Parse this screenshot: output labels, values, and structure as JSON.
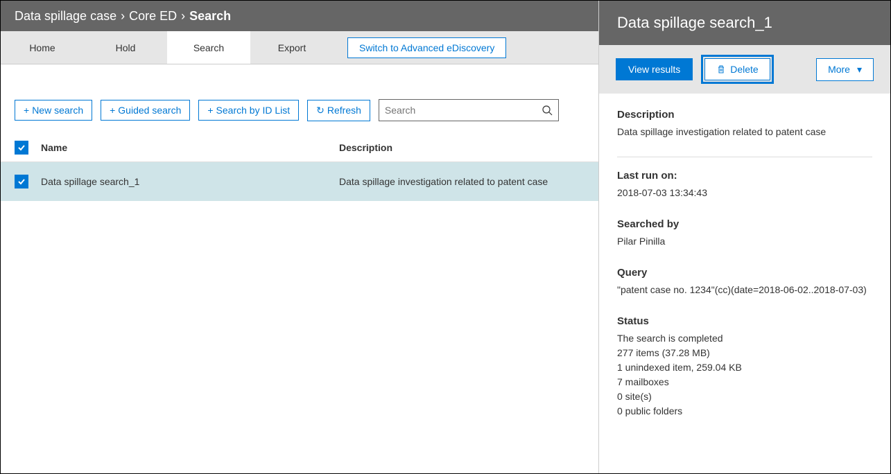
{
  "breadcrumb": {
    "crumb1": "Data spillage case",
    "crumb2": "Core ED",
    "crumb3": "Search"
  },
  "tabs": {
    "home": "Home",
    "hold": "Hold",
    "search": "Search",
    "export": "Export",
    "switch": "Switch to Advanced eDiscovery"
  },
  "toolbar": {
    "new_search": "New search",
    "guided_search": "Guided search",
    "search_by_id": "Search by ID List",
    "refresh": "Refresh",
    "search_placeholder": "Search"
  },
  "table": {
    "col_name": "Name",
    "col_desc": "Description",
    "rows": [
      {
        "name": "Data spillage search_1",
        "desc": "Data spillage investigation related to patent case"
      }
    ]
  },
  "panel": {
    "title": "Data spillage search_1",
    "view_results": "View results",
    "delete": "Delete",
    "more": "More",
    "description_label": "Description",
    "description_value": "Data spillage investigation related to patent case",
    "last_run_label": "Last run on:",
    "last_run_value": "2018-07-03 13:34:43",
    "searched_by_label": "Searched by",
    "searched_by_value": "Pilar Pinilla",
    "query_label": "Query",
    "query_value": "\"patent case no. 1234\"(cc)(date=2018-06-02..2018-07-03)",
    "status_label": "Status",
    "status_lines": [
      "The search is completed",
      "277 items (37.28 MB)",
      "1 unindexed item, 259.04 KB",
      "7 mailboxes",
      "0 site(s)",
      "0 public folders"
    ]
  }
}
